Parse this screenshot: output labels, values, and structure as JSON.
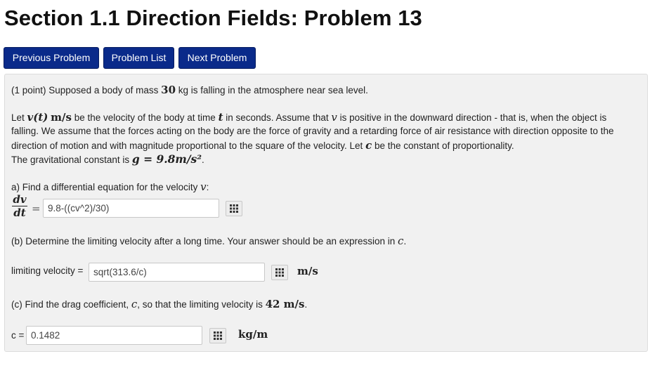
{
  "page": {
    "title": "Section 1.1 Direction Fields: Problem 13"
  },
  "nav": {
    "previous": "Previous Problem",
    "list": "Problem List",
    "next": "Next Problem"
  },
  "problem": {
    "intro_pre": "(1 point) Supposed a body of mass ",
    "mass": "30",
    "intro_post": " kg is falling in the atmosphere near sea level.",
    "p2_let": "Let ",
    "vt": "v(t)",
    "ms_unit": "m/s",
    "p2_mid": " be the velocity of the body at time ",
    "t_var": "t",
    "p2_mid2": " in seconds. Assume that ",
    "v_var": "v",
    "p2_end": " is positive in the downward direction - that is, when the object is",
    "p2_line2": "falling. We assume that the forces acting on the body are the force of gravity and a retarding force of air resistance with direction opposite to the",
    "p2_line3_pre": "direction of motion and with magnitude proportional to the square of the velocity. Let ",
    "c_var": "c",
    "p2_line3_post": " be the constant of proportionality.",
    "grav_pre": "The gravitational constant is ",
    "grav_eq": "g = 9.8m/s²",
    "grav_post": ".",
    "a_label": "a) Find a differential equation for the velocity ",
    "a_var": "v",
    "a_colon": ":",
    "frac_num": "dv",
    "frac_den": "dt",
    "eq_sign": "=",
    "a_answer": "9.8-((cv^2)/30)",
    "b_label_pre": "(b) Determine the limiting velocity after a long time. Your answer should be an expression in ",
    "b_var": "c",
    "b_label_post": ".",
    "b_field_label": "limiting velocity = ",
    "b_answer": "sqrt(313.6/c)",
    "b_unit": "m/s",
    "c_label_pre": "(c) Find the drag coefficient, ",
    "c_label_var": "c",
    "c_label_mid": ", so that the limiting velocity is ",
    "c_label_val": "42 m/s",
    "c_label_post": ".",
    "c_field_var": "c",
    "c_field_eq": " = ",
    "c_answer": "0.1482",
    "c_unit": "kg/m"
  },
  "icons": {
    "equation_editor": "grid-icon"
  },
  "colors": {
    "nav_button": "#0a2a8a",
    "panel_bg": "#f1f1f1"
  }
}
